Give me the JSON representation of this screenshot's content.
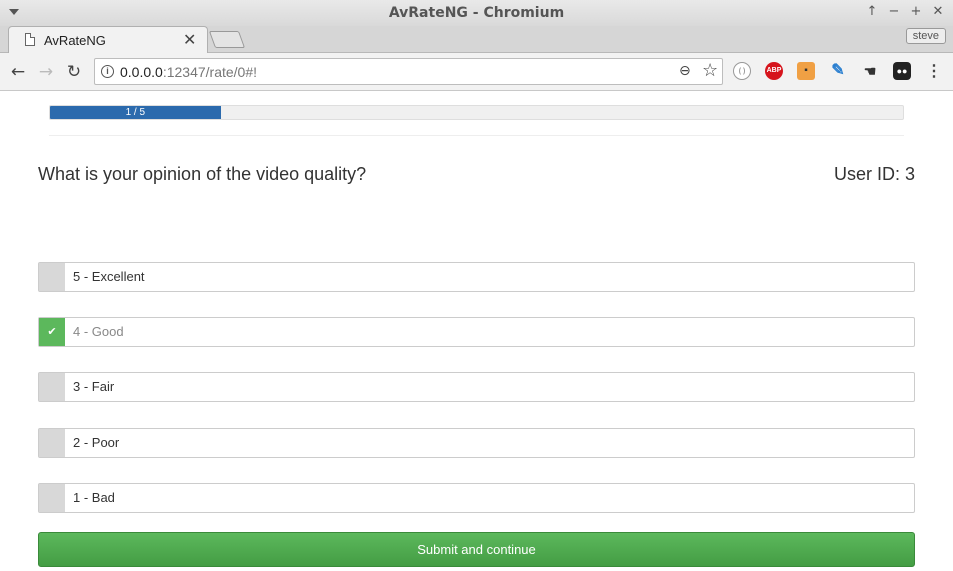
{
  "window": {
    "title": "AvRateNG - Chromium",
    "profile": "steve"
  },
  "tab": {
    "title": "AvRateNG"
  },
  "address": {
    "host": "0.0.0.0",
    "rest": ":12347/rate/0#!"
  },
  "progress": {
    "label": "1 / 5",
    "fraction": 0.2
  },
  "question": "What is your opinion of the video quality?",
  "user_id": "User ID: 3",
  "options": [
    {
      "label": "5 - Excellent",
      "checked": false
    },
    {
      "label": "4 - Good",
      "checked": true
    },
    {
      "label": "3 - Fair",
      "checked": false
    },
    {
      "label": "2 - Poor",
      "checked": false
    },
    {
      "label": "1 - Bad",
      "checked": false
    }
  ],
  "submit_label": "Submit and continue",
  "colors": {
    "progress": "#2b6aad",
    "checked": "#5cb85c",
    "submit": "#5cb85c"
  }
}
